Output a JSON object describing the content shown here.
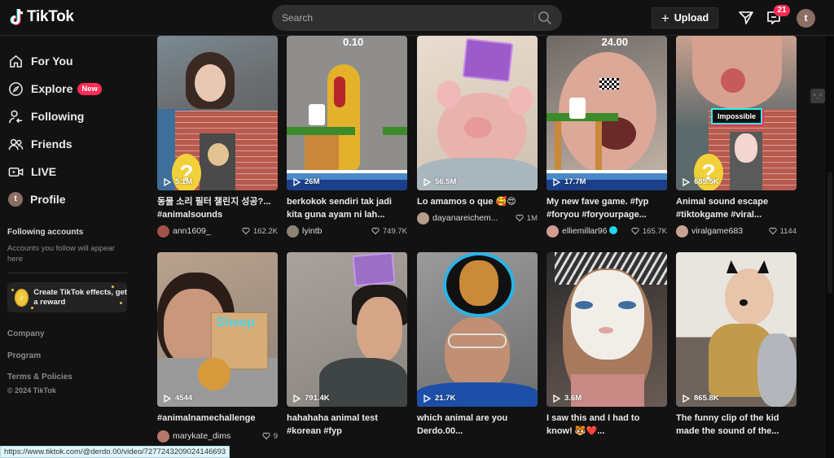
{
  "app": {
    "name": "TikTok",
    "brand_color": "#fe2c55",
    "accent_cyan": "#25f4ee"
  },
  "header": {
    "search": {
      "placeholder": "Search",
      "value": ""
    },
    "upload_label": "Upload",
    "upload_icon": "plus-icon",
    "inbox_icon": "paper-plane-icon",
    "messages_icon": "message-icon",
    "messages_badge": "21",
    "user_initial": "t"
  },
  "sidebar": {
    "items": [
      {
        "label": "For You",
        "icon": "home-icon"
      },
      {
        "label": "Explore",
        "icon": "compass-icon",
        "badge": "New"
      },
      {
        "label": "Following",
        "icon": "user-follow-icon"
      },
      {
        "label": "Friends",
        "icon": "friends-icon"
      },
      {
        "label": "LIVE",
        "icon": "live-camera-icon"
      },
      {
        "label": "Profile",
        "icon": "avatar",
        "initial": "t"
      }
    ],
    "following_accounts": {
      "title": "Following accounts",
      "description": "Accounts you follow will appear here"
    },
    "effects_card": {
      "label": "Create TikTok effects, get a reward"
    },
    "footer_links": [
      "Company",
      "Program",
      "Terms & Policies"
    ],
    "copyright": "© 2024 TikTok"
  },
  "videos": [
    {
      "views": "5.1M",
      "caption": "동물 소리 필터 챌린지 성공?... #animalsounds",
      "author": "ann1609_",
      "likes": "162.2K",
      "verified": false
    },
    {
      "views": "26M",
      "caption": "berkokok sendiri tak jadi kita guna ayam ni lah...",
      "author": "lyintb",
      "likes": "749.7K",
      "verified": false,
      "overlay_score": "0.10"
    },
    {
      "views": "56.5M",
      "caption": "Lo amamos o que 🥰😍",
      "author": "dayanareichem...",
      "likes": "1M",
      "verified": false
    },
    {
      "views": "17.7M",
      "caption": "My new fave game. #fyp #foryou #foryourpage...",
      "author": "elliemillar96",
      "likes": "165.7K",
      "verified": true,
      "overlay_score": "24.00"
    },
    {
      "views": "685.5K",
      "caption": "Animal sound escape #tiktokgame #viral...",
      "author": "viralgame683",
      "likes": "1144",
      "verified": false,
      "overlay_label": "Impossible"
    },
    {
      "views": "4544",
      "caption": "#animalnamechallenge",
      "author": "marykate_dims",
      "likes": "9",
      "verified": false,
      "overlay_label": "Sheep"
    },
    {
      "views": "791.4K",
      "caption": "hahahaha animal test #korean #fyp",
      "author": "",
      "likes": "",
      "verified": false
    },
    {
      "views": "21.7K",
      "caption": "which animal are you Derdo.00...",
      "author": "",
      "likes": "",
      "verified": false
    },
    {
      "views": "3.6M",
      "caption": "I saw this and I had to know! 🐯❤️...",
      "author": "",
      "likes": "",
      "verified": false
    },
    {
      "views": "865.8K",
      "caption": "The funny clip of the kid made the sound of the...",
      "author": "",
      "likes": "",
      "verified": false
    }
  ],
  "status_bar": {
    "url": "https://www.tiktok.com/@derdo.00/video/7277243209024146693"
  }
}
